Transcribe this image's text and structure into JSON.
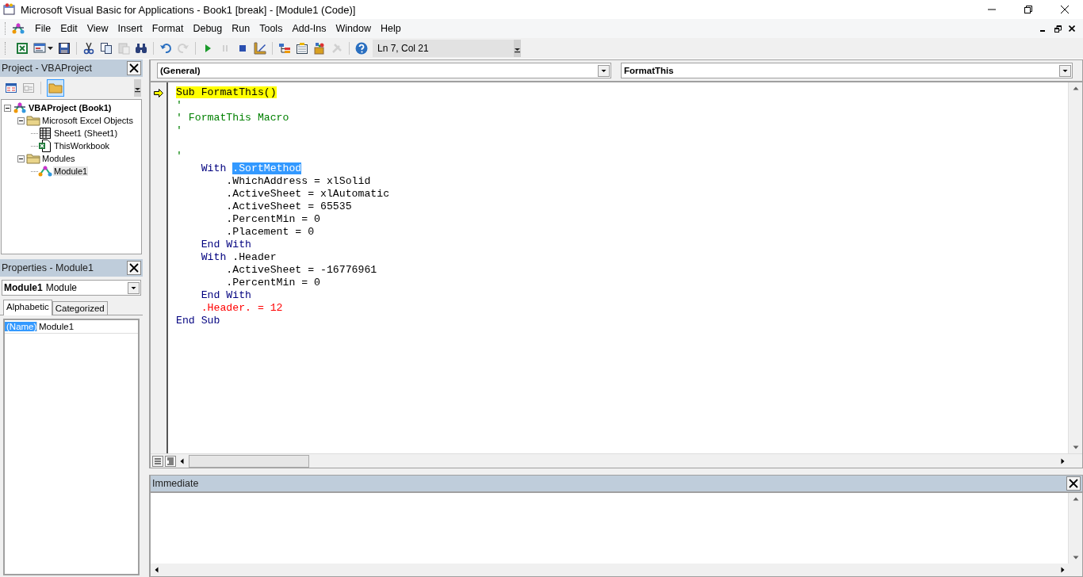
{
  "window": {
    "title": "Microsoft Visual Basic for Applications - Book1 [break] - [Module1 (Code)]"
  },
  "menu": [
    "File",
    "Edit",
    "View",
    "Insert",
    "Format",
    "Debug",
    "Run",
    "Tools",
    "Add-Ins",
    "Window",
    "Help"
  ],
  "toolbar": {
    "buttons": [
      {
        "kind": "excel",
        "disabled": false
      },
      {
        "kind": "userform",
        "disabled": false
      },
      {
        "kind": "save",
        "disabled": false
      },
      {
        "kind": "sep"
      },
      {
        "kind": "cut",
        "disabled": false
      },
      {
        "kind": "copy",
        "disabled": false
      },
      {
        "kind": "paste",
        "disabled": true
      },
      {
        "kind": "find",
        "disabled": false
      },
      {
        "kind": "sep"
      },
      {
        "kind": "undo",
        "disabled": false
      },
      {
        "kind": "redo",
        "disabled": true
      },
      {
        "kind": "sep"
      },
      {
        "kind": "run",
        "disabled": false
      },
      {
        "kind": "pause",
        "disabled": true
      },
      {
        "kind": "stop",
        "disabled": false
      },
      {
        "kind": "design",
        "disabled": false
      },
      {
        "kind": "sep"
      },
      {
        "kind": "explorer",
        "disabled": false
      },
      {
        "kind": "properties",
        "disabled": false
      },
      {
        "kind": "browser",
        "disabled": false
      },
      {
        "kind": "toolbox",
        "disabled": true
      },
      {
        "kind": "sep"
      },
      {
        "kind": "help",
        "disabled": false
      }
    ],
    "position": "Ln 7, Col 21"
  },
  "project": {
    "title": "Project - VBAProject",
    "tree": [
      {
        "label": "VBAProject (Book1)",
        "kind": "project",
        "expanded": true,
        "selected": false,
        "children": [
          {
            "label": "Microsoft Excel Objects",
            "kind": "folder",
            "expanded": true,
            "selected": false,
            "children": [
              {
                "label": "Sheet1 (Sheet1)",
                "kind": "sheet",
                "selected": false
              },
              {
                "label": "ThisWorkbook",
                "kind": "workbook",
                "selected": false
              }
            ]
          },
          {
            "label": "Modules",
            "kind": "folder",
            "expanded": true,
            "selected": false,
            "children": [
              {
                "label": "Module1",
                "kind": "module",
                "selected": true
              }
            ]
          }
        ]
      }
    ]
  },
  "properties": {
    "title": "Properties - Module1",
    "object_name": "Module1",
    "object_type": "Module",
    "tabs": [
      {
        "label": "Alphabetic",
        "selected": true
      },
      {
        "label": "Categorized",
        "selected": false
      }
    ],
    "rows": [
      {
        "name": "(Name)",
        "value": "Module1",
        "selected": true
      }
    ]
  },
  "code_window": {
    "object": "(General)",
    "procedure": "FormatThis",
    "lines": [
      {
        "kind": "code",
        "current": true,
        "segments": [
          {
            "text": "Sub FormatThis()",
            "kind": "plain"
          }
        ]
      },
      {
        "kind": "code",
        "current": false,
        "segments": [
          {
            "text": "'",
            "kind": "comment"
          }
        ]
      },
      {
        "kind": "code",
        "current": false,
        "segments": [
          {
            "text": "' FormatThis Macro",
            "kind": "comment"
          }
        ]
      },
      {
        "kind": "code",
        "current": false,
        "segments": [
          {
            "text": "'",
            "kind": "comment"
          }
        ]
      },
      {
        "kind": "blank"
      },
      {
        "kind": "code",
        "current": false,
        "segments": [
          {
            "text": "'",
            "kind": "comment"
          }
        ]
      },
      {
        "kind": "code",
        "current": false,
        "segments": [
          {
            "text": "    With ",
            "kind": "keyword"
          },
          {
            "text": ".SortMethod",
            "kind": "selected"
          }
        ]
      },
      {
        "kind": "code",
        "current": false,
        "segments": [
          {
            "text": "        .WhichAddress = xlSolid",
            "kind": "plain"
          }
        ]
      },
      {
        "kind": "code",
        "current": false,
        "segments": [
          {
            "text": "        .ActiveSheet = xlAutomatic",
            "kind": "plain"
          }
        ]
      },
      {
        "kind": "code",
        "current": false,
        "segments": [
          {
            "text": "        .ActiveSheet = 65535",
            "kind": "plain"
          }
        ]
      },
      {
        "kind": "code",
        "current": false,
        "segments": [
          {
            "text": "        .PercentMin = 0",
            "kind": "plain"
          }
        ]
      },
      {
        "kind": "code",
        "current": false,
        "segments": [
          {
            "text": "        .Placement = 0",
            "kind": "plain"
          }
        ]
      },
      {
        "kind": "code",
        "current": false,
        "segments": [
          {
            "text": "    End With",
            "kind": "keyword"
          }
        ]
      },
      {
        "kind": "code",
        "current": false,
        "segments": [
          {
            "text": "    With",
            "kind": "keyword"
          },
          {
            "text": " .Header",
            "kind": "plain"
          }
        ]
      },
      {
        "kind": "code",
        "current": false,
        "segments": [
          {
            "text": "        .ActiveSheet = -16776961",
            "kind": "plain"
          }
        ]
      },
      {
        "kind": "code",
        "current": false,
        "segments": [
          {
            "text": "        .PercentMin = 0",
            "kind": "plain"
          }
        ]
      },
      {
        "kind": "code",
        "current": false,
        "segments": [
          {
            "text": "    End With",
            "kind": "keyword"
          }
        ]
      },
      {
        "kind": "code",
        "current": false,
        "segments": [
          {
            "text": "    .Header. = 12",
            "kind": "error"
          }
        ]
      },
      {
        "kind": "code",
        "current": false,
        "segments": [
          {
            "text": "End Sub",
            "kind": "keyword"
          }
        ]
      }
    ]
  },
  "immediate": {
    "title": "Immediate"
  }
}
